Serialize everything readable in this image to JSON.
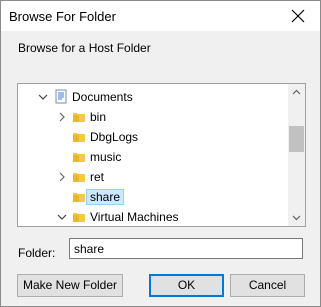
{
  "window": {
    "title": "Browse For Folder"
  },
  "prompt": "Browse for a Host Folder",
  "tree": {
    "items": [
      {
        "label": "Documents",
        "icon": "documents-folder-icon",
        "expander": "expanded"
      },
      {
        "label": "bin",
        "icon": "folder-icon",
        "expander": "collapsed"
      },
      {
        "label": "DbgLogs",
        "icon": "folder-icon",
        "expander": "none"
      },
      {
        "label": "music",
        "icon": "folder-icon",
        "expander": "none"
      },
      {
        "label": "ret",
        "icon": "folder-icon",
        "expander": "collapsed"
      },
      {
        "label": "share",
        "icon": "folder-icon",
        "expander": "none",
        "selected": true
      },
      {
        "label": "Virtual Machines",
        "icon": "folder-icon",
        "expander": "expanded"
      }
    ]
  },
  "folder": {
    "label": "Folder:",
    "value": "share"
  },
  "buttons": {
    "new_folder": "Make New Folder",
    "ok": "OK",
    "cancel": "Cancel"
  },
  "colors": {
    "accent": "#0078d7",
    "selection": "#cce8ff",
    "folder_yellow": "#f7c948"
  }
}
